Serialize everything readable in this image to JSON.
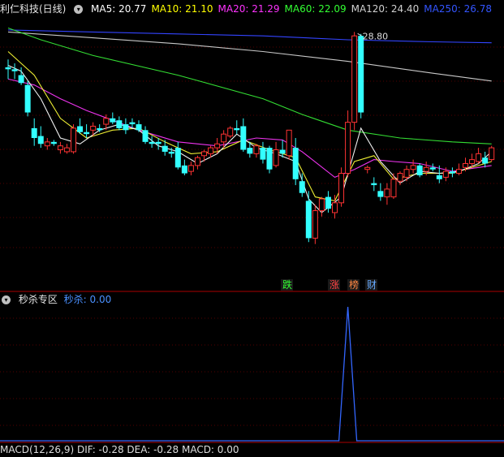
{
  "main": {
    "title": "利仁科技(日线)",
    "ma": [
      {
        "label": "MA5: 20.77",
        "color": "#ffffff"
      },
      {
        "label": "MA10: 21.10",
        "color": "#ffff00"
      },
      {
        "label": "MA20: 21.29",
        "color": "#ff33ff"
      },
      {
        "label": "MA60: 22.09",
        "color": "#33ff33"
      },
      {
        "label": "MA120: 24.40",
        "color": "#d0d0d0"
      },
      {
        "label": "MA250: 26.78",
        "color": "#3355ff"
      }
    ],
    "peak_label": "28.80",
    "tags": [
      {
        "text": "跌",
        "color": "#33ff33",
        "bg": "#1a1a1a"
      },
      {
        "text": "涨",
        "color": "#ff4444",
        "bg": "#1a1a1a"
      },
      {
        "text": "榜",
        "color": "#ff8844",
        "bg": "#1a1a1a"
      },
      {
        "text": "财",
        "color": "#66aaff",
        "bg": "#1a1a1a"
      }
    ]
  },
  "sub": {
    "title": "秒杀专区",
    "value_label": "秒杀: 0.00"
  },
  "bottom": {
    "text": "MACD(12,26,9)  DIF: -0.28  DEA: -0.28  MACD: 0.00"
  },
  "colors": {
    "up": "#ff3333",
    "down": "#33ffff",
    "grid": "#550000",
    "axis": "#aa0000"
  },
  "chart_data": {
    "type": "candlestick",
    "price_range": [
      17.4,
      29.8
    ],
    "candles": [
      [
        27.2,
        27.6,
        26.6,
        27.1
      ],
      [
        27.1,
        27.4,
        26.6,
        27.0
      ],
      [
        26.8,
        27.2,
        26.3,
        26.4
      ],
      [
        26.3,
        26.5,
        24.7,
        24.9
      ],
      [
        24.1,
        24.6,
        23.2,
        23.6
      ],
      [
        23.7,
        24.2,
        23.1,
        23.3
      ],
      [
        23.2,
        23.6,
        23.0,
        23.4
      ],
      [
        23.4,
        23.5,
        23.2,
        23.3
      ],
      [
        23.0,
        23.4,
        22.8,
        23.2
      ],
      [
        22.9,
        23.3,
        22.8,
        23.1
      ],
      [
        22.9,
        24.3,
        22.8,
        24.1
      ],
      [
        24.2,
        24.6,
        23.8,
        23.9
      ],
      [
        23.9,
        24.3,
        23.6,
        23.8
      ],
      [
        24.0,
        24.4,
        23.7,
        24.2
      ],
      [
        24.1,
        24.3,
        23.9,
        24.0
      ],
      [
        24.3,
        24.8,
        24.0,
        24.6
      ],
      [
        24.6,
        24.9,
        24.3,
        24.4
      ],
      [
        24.5,
        24.7,
        24.0,
        24.1
      ],
      [
        24.3,
        24.6,
        23.8,
        24.0
      ],
      [
        24.4,
        24.6,
        24.1,
        24.3
      ],
      [
        24.3,
        24.5,
        23.9,
        24.0
      ],
      [
        24.0,
        24.2,
        23.3,
        23.4
      ],
      [
        23.4,
        23.7,
        23.1,
        23.3
      ],
      [
        23.4,
        23.6,
        23.0,
        23.3
      ],
      [
        23.2,
        23.5,
        22.7,
        22.9
      ],
      [
        22.9,
        23.1,
        22.6,
        22.8
      ],
      [
        23.1,
        23.4,
        22.0,
        22.1
      ],
      [
        22.2,
        22.5,
        21.7,
        21.8
      ],
      [
        21.9,
        22.4,
        21.7,
        22.2
      ],
      [
        22.2,
        22.7,
        22.0,
        22.6
      ],
      [
        22.7,
        23.0,
        22.4,
        22.9
      ],
      [
        22.8,
        23.2,
        22.6,
        23.1
      ],
      [
        23.1,
        23.6,
        22.8,
        23.3
      ],
      [
        23.4,
        24.0,
        23.1,
        23.8
      ],
      [
        23.7,
        24.2,
        23.6,
        24.1
      ],
      [
        24.1,
        24.5,
        23.8,
        24.0
      ],
      [
        24.2,
        24.6,
        22.9,
        23.0
      ],
      [
        23.1,
        23.4,
        22.6,
        22.8
      ],
      [
        22.8,
        23.3,
        22.6,
        23.2
      ],
      [
        23.1,
        23.4,
        22.3,
        22.5
      ],
      [
        23.1,
        23.2,
        21.8,
        22.0
      ],
      [
        22.2,
        23.4,
        22.1,
        23.0
      ],
      [
        23.0,
        23.5,
        22.6,
        22.8
      ],
      [
        22.7,
        24.0,
        22.5,
        24.0
      ],
      [
        23.1,
        23.6,
        21.2,
        21.5
      ],
      [
        21.4,
        21.8,
        20.6,
        20.8
      ],
      [
        20.4,
        20.9,
        18.3,
        18.5
      ],
      [
        18.5,
        20.2,
        18.2,
        19.9
      ],
      [
        19.9,
        20.6,
        19.6,
        20.5
      ],
      [
        20.6,
        20.9,
        19.8,
        20.0
      ],
      [
        19.8,
        20.7,
        19.5,
        20.3
      ],
      [
        20.3,
        22.1,
        20.1,
        21.8
      ],
      [
        21.8,
        25.0,
        21.6,
        24.4
      ],
      [
        24.4,
        29.0,
        24.0,
        28.8
      ],
      [
        28.8,
        28.9,
        24.6,
        24.9
      ],
      [
        22.0,
        22.2,
        21.8,
        22.1
      ],
      [
        21.3,
        21.6,
        20.9,
        21.2
      ],
      [
        20.9,
        21.3,
        20.4,
        20.6
      ],
      [
        20.6,
        21.3,
        20.2,
        21.0
      ],
      [
        20.6,
        21.8,
        20.5,
        21.5
      ],
      [
        21.4,
        21.9,
        21.2,
        21.8
      ],
      [
        21.6,
        22.2,
        21.4,
        22.0
      ],
      [
        22.0,
        22.5,
        21.8,
        22.2
      ],
      [
        22.2,
        22.3,
        21.6,
        21.7
      ],
      [
        21.9,
        22.4,
        21.7,
        22.1
      ],
      [
        22.1,
        22.3,
        21.9,
        22.0
      ],
      [
        21.7,
        22.2,
        21.3,
        21.5
      ],
      [
        21.6,
        22.1,
        21.4,
        21.9
      ],
      [
        21.9,
        22.1,
        21.6,
        21.8
      ],
      [
        21.8,
        22.3,
        21.7,
        22.0
      ],
      [
        22.1,
        22.6,
        21.9,
        22.3
      ],
      [
        22.3,
        22.8,
        22.1,
        22.5
      ],
      [
        22.4,
        23.1,
        22.3,
        22.8
      ],
      [
        22.6,
        22.9,
        22.1,
        22.3
      ],
      [
        22.5,
        23.2,
        22.4,
        23.1
      ]
    ],
    "ma250": [
      [
        0,
        29.1
      ],
      [
        13,
        29.0
      ],
      [
        26,
        28.9
      ],
      [
        39,
        28.8
      ],
      [
        52,
        28.6
      ],
      [
        65,
        28.5
      ],
      [
        74,
        28.45
      ]
    ],
    "ma120": [
      [
        0,
        29.0
      ],
      [
        13,
        28.7
      ],
      [
        26,
        28.4
      ],
      [
        39,
        28.0
      ],
      [
        52,
        27.5
      ],
      [
        65,
        26.9
      ],
      [
        74,
        26.5
      ]
    ],
    "ma60": [
      [
        0,
        29.2
      ],
      [
        5,
        28.6
      ],
      [
        13,
        27.8
      ],
      [
        26,
        26.8
      ],
      [
        39,
        25.6
      ],
      [
        45,
        24.8
      ],
      [
        52,
        24.0
      ],
      [
        60,
        23.6
      ],
      [
        68,
        23.4
      ],
      [
        74,
        23.3
      ]
    ],
    "ma20": [
      [
        0,
        26.6
      ],
      [
        4,
        26.3
      ],
      [
        8,
        25.6
      ],
      [
        12,
        25.0
      ],
      [
        16,
        24.5
      ],
      [
        20,
        24.0
      ],
      [
        26,
        23.4
      ],
      [
        32,
        23.2
      ],
      [
        38,
        23.6
      ],
      [
        42,
        23.5
      ],
      [
        45,
        22.9
      ],
      [
        50,
        21.6
      ],
      [
        53,
        22.0
      ],
      [
        56,
        22.5
      ],
      [
        59,
        22.4
      ],
      [
        63,
        22.3
      ],
      [
        68,
        21.9
      ],
      [
        74,
        22.2
      ]
    ],
    "ma10": [
      [
        0,
        28.0
      ],
      [
        4,
        26.8
      ],
      [
        8,
        24.6
      ],
      [
        12,
        23.6
      ],
      [
        16,
        24.0
      ],
      [
        20,
        24.1
      ],
      [
        24,
        23.4
      ],
      [
        28,
        22.8
      ],
      [
        32,
        22.9
      ],
      [
        36,
        23.5
      ],
      [
        40,
        23.0
      ],
      [
        44,
        22.6
      ],
      [
        47,
        20.6
      ],
      [
        50,
        20.4
      ],
      [
        53,
        22.4
      ],
      [
        56,
        22.7
      ],
      [
        59,
        21.5
      ],
      [
        63,
        21.8
      ],
      [
        68,
        21.8
      ],
      [
        74,
        22.4
      ]
    ],
    "ma5": [
      [
        0,
        27.3
      ],
      [
        2,
        27.0
      ],
      [
        5,
        25.6
      ],
      [
        8,
        23.6
      ],
      [
        11,
        23.3
      ],
      [
        14,
        24.0
      ],
      [
        17,
        24.3
      ],
      [
        20,
        24.0
      ],
      [
        23,
        23.2
      ],
      [
        26,
        22.9
      ],
      [
        29,
        22.3
      ],
      [
        32,
        22.8
      ],
      [
        35,
        23.8
      ],
      [
        38,
        23.1
      ],
      [
        41,
        22.8
      ],
      [
        44,
        22.4
      ],
      [
        46,
        20.5
      ],
      [
        48,
        19.8
      ],
      [
        51,
        20.6
      ],
      [
        54,
        24.1
      ],
      [
        57,
        22.4
      ],
      [
        60,
        21.3
      ],
      [
        63,
        21.9
      ],
      [
        66,
        21.8
      ],
      [
        69,
        21.9
      ],
      [
        72,
        22.3
      ],
      [
        74,
        22.9
      ]
    ],
    "kill_spike": {
      "index": 52,
      "value": 1.0
    },
    "kill_value": 0.0
  }
}
